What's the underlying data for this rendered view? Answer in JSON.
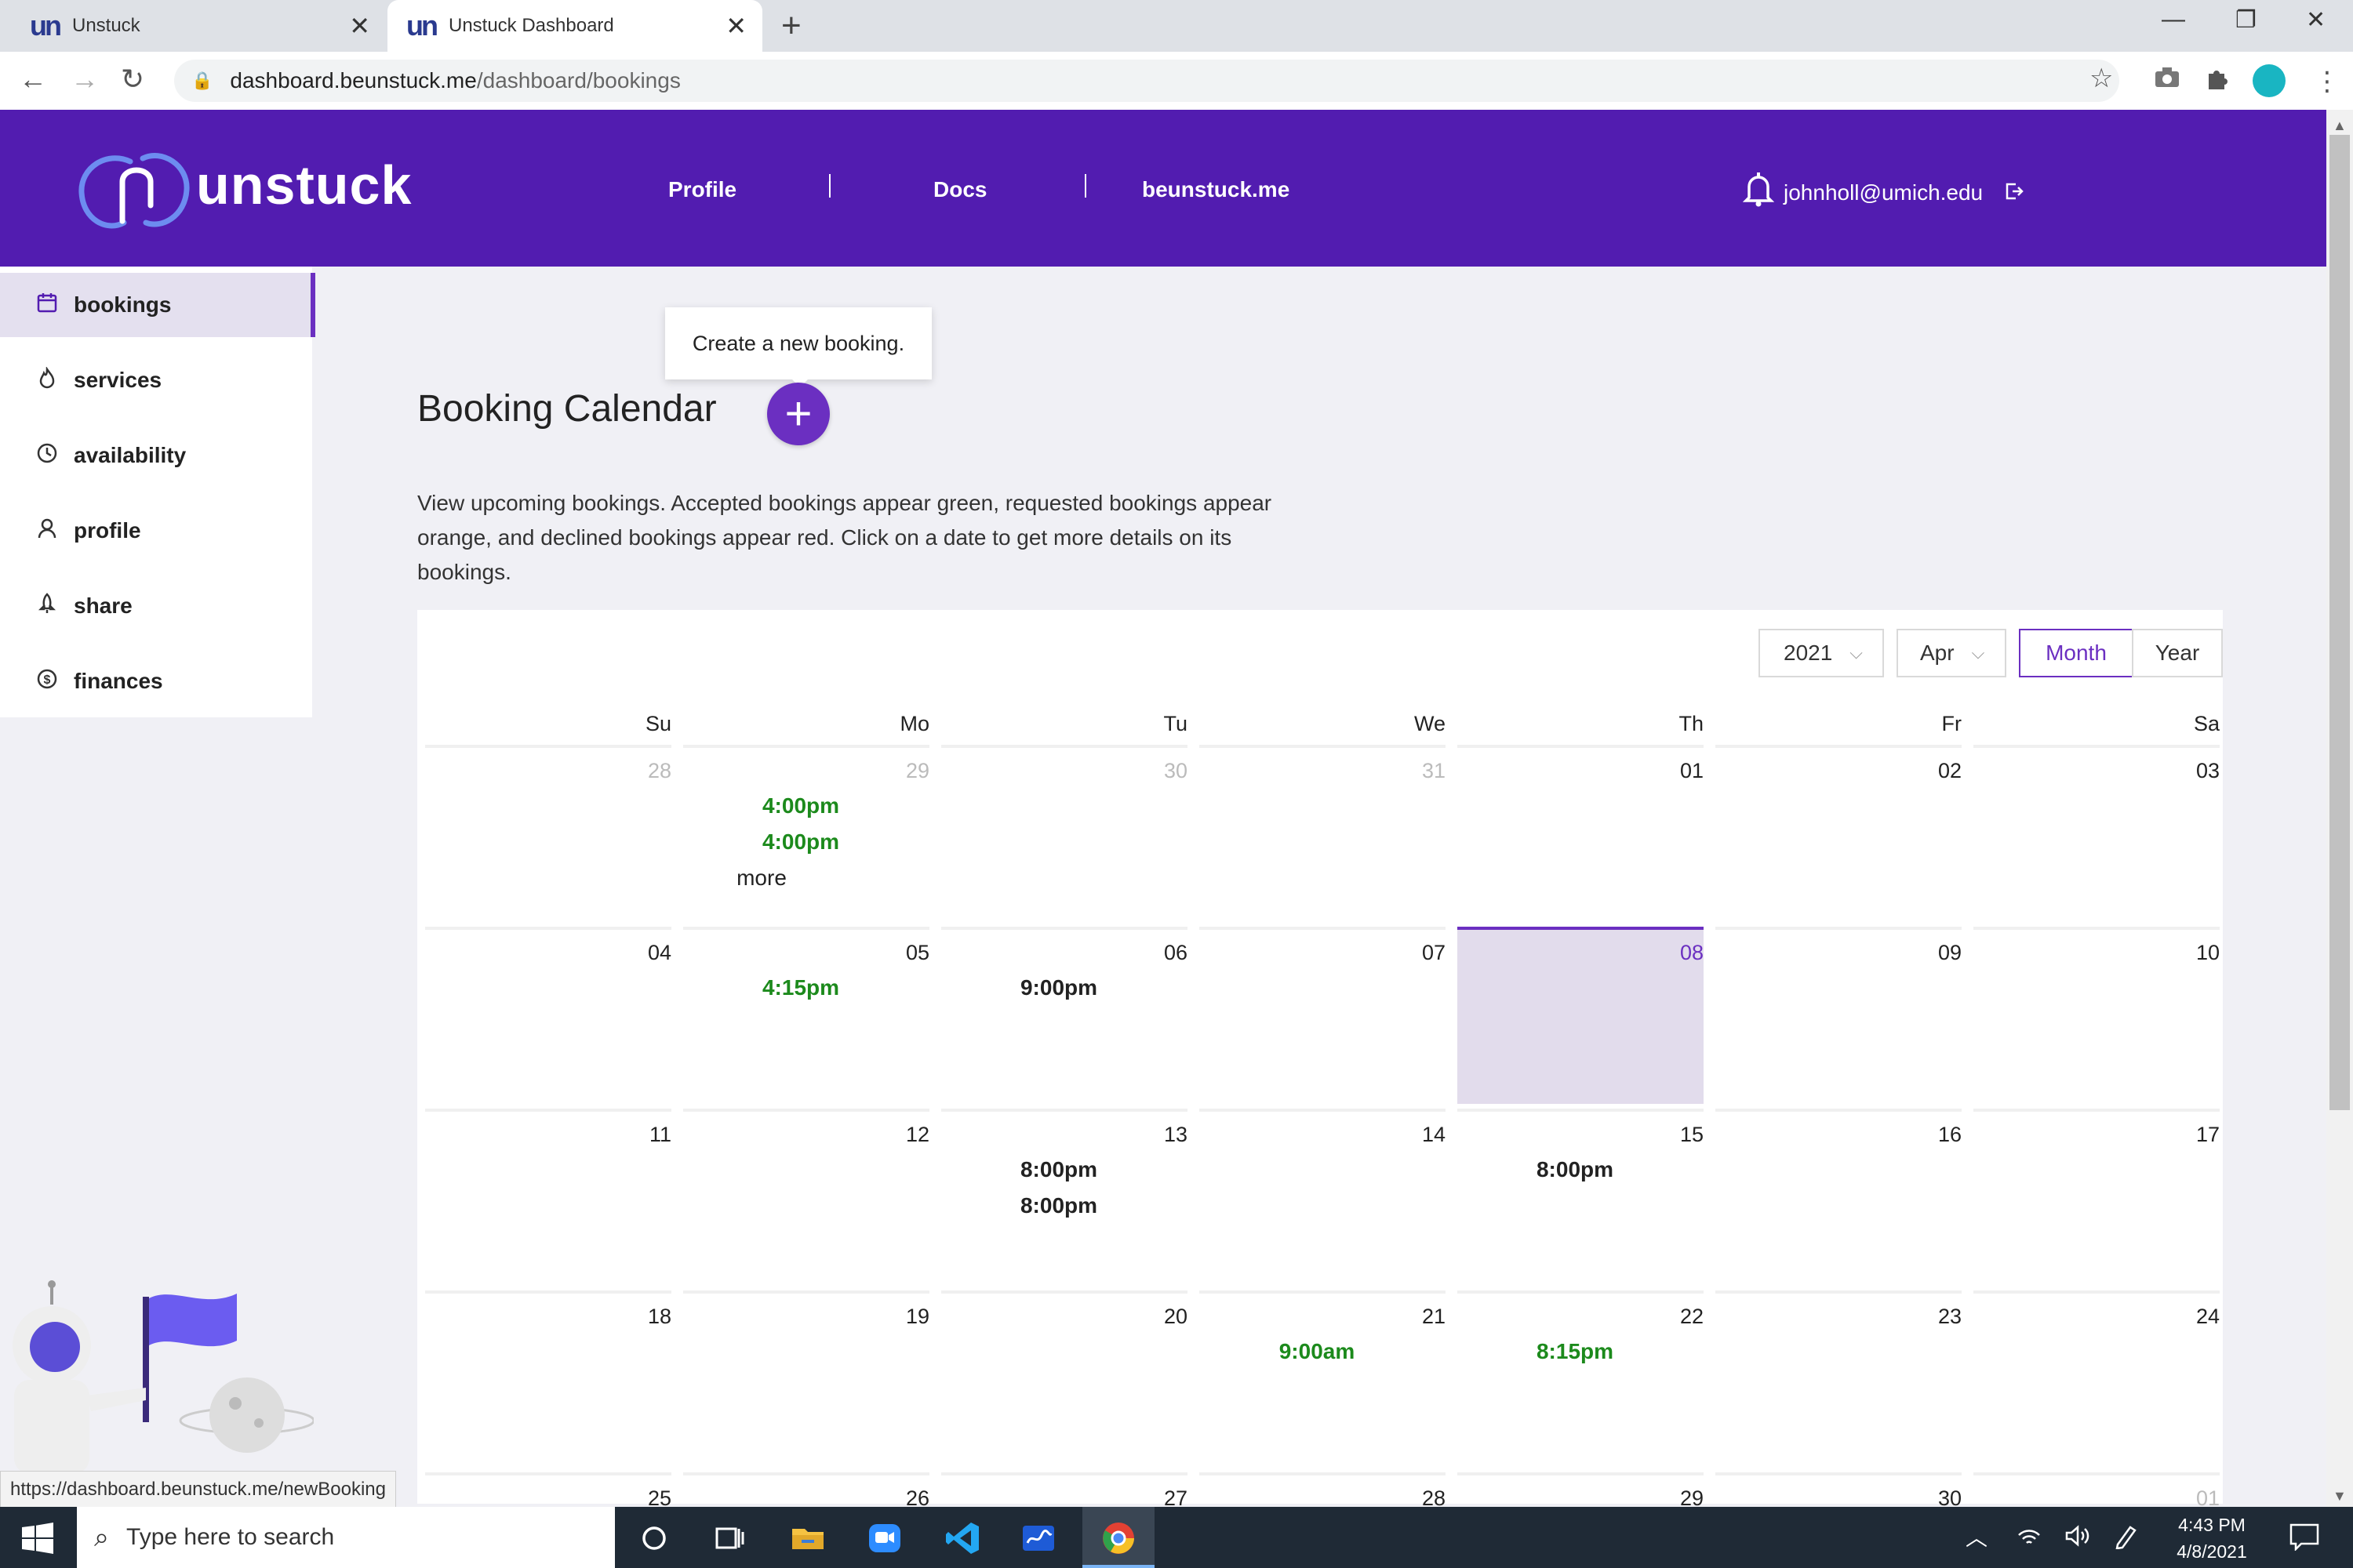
{
  "browser": {
    "tabs": [
      {
        "title": "Unstuck",
        "favicon": "un"
      },
      {
        "title": "Unstuck Dashboard",
        "favicon": "un"
      }
    ],
    "url_host": "dashboard.beunstuck.me",
    "url_path": "/dashboard/bookings",
    "status_url": "https://dashboard.beunstuck.me/newBooking"
  },
  "header": {
    "logo": "unstuck",
    "nav": [
      "Profile",
      "Docs",
      "beunstuck.me"
    ],
    "user_email": "johnholl@umich.edu"
  },
  "sidebar": {
    "items": [
      {
        "label": "bookings",
        "icon": "calendar-icon",
        "active": true
      },
      {
        "label": "services",
        "icon": "flame-icon"
      },
      {
        "label": "availability",
        "icon": "clock-icon"
      },
      {
        "label": "profile",
        "icon": "person-icon"
      },
      {
        "label": "share",
        "icon": "rocket-icon"
      },
      {
        "label": "finances",
        "icon": "dollar-circle-icon"
      }
    ]
  },
  "main": {
    "tooltip": "Create a new booking.",
    "title": "Booking Calendar",
    "description": "View upcoming bookings. Accepted bookings appear green, requested bookings appear orange, and declined bookings appear red. Click on a date to get more details on its bookings."
  },
  "calendar": {
    "year": "2021",
    "month": "Apr",
    "mode_month": "Month",
    "mode_year": "Year",
    "weekdays": [
      "Su",
      "Mo",
      "Tu",
      "We",
      "Th",
      "Fr",
      "Sa"
    ],
    "weeks": [
      [
        {
          "day": "28",
          "out": true,
          "events": []
        },
        {
          "day": "29",
          "out": true,
          "events": [
            {
              "time": "4:00pm",
              "status": "accepted"
            },
            {
              "time": "4:00pm",
              "status": "accepted"
            }
          ],
          "more": "more"
        },
        {
          "day": "30",
          "out": true,
          "events": []
        },
        {
          "day": "31",
          "out": true,
          "events": []
        },
        {
          "day": "01",
          "events": []
        },
        {
          "day": "02",
          "events": []
        },
        {
          "day": "03",
          "events": []
        }
      ],
      [
        {
          "day": "04",
          "events": []
        },
        {
          "day": "05",
          "events": [
            {
              "time": "4:15pm",
              "status": "accepted"
            }
          ]
        },
        {
          "day": "06",
          "events": [
            {
              "time": "9:00pm",
              "status": "other"
            }
          ]
        },
        {
          "day": "07",
          "events": []
        },
        {
          "day": "08",
          "today": true,
          "events": []
        },
        {
          "day": "09",
          "events": []
        },
        {
          "day": "10",
          "events": []
        }
      ],
      [
        {
          "day": "11",
          "events": []
        },
        {
          "day": "12",
          "events": []
        },
        {
          "day": "13",
          "events": [
            {
              "time": "8:00pm",
              "status": "other"
            },
            {
              "time": "8:00pm",
              "status": "other"
            }
          ]
        },
        {
          "day": "14",
          "events": []
        },
        {
          "day": "15",
          "events": [
            {
              "time": "8:00pm",
              "status": "other"
            }
          ]
        },
        {
          "day": "16",
          "events": []
        },
        {
          "day": "17",
          "events": []
        }
      ],
      [
        {
          "day": "18",
          "events": []
        },
        {
          "day": "19",
          "events": []
        },
        {
          "day": "20",
          "events": []
        },
        {
          "day": "21",
          "events": [
            {
              "time": "9:00am",
              "status": "accepted"
            }
          ]
        },
        {
          "day": "22",
          "events": [
            {
              "time": "8:15pm",
              "status": "accepted"
            }
          ]
        },
        {
          "day": "23",
          "events": []
        },
        {
          "day": "24",
          "events": []
        }
      ],
      [
        {
          "day": "25",
          "events": []
        },
        {
          "day": "26",
          "events": []
        },
        {
          "day": "27",
          "events": []
        },
        {
          "day": "28",
          "events": []
        },
        {
          "day": "29",
          "events": []
        },
        {
          "day": "30",
          "events": []
        },
        {
          "day": "01",
          "out": true,
          "events": []
        }
      ]
    ]
  },
  "colors": {
    "brand": "#521cb0",
    "accent": "#6b2fc1",
    "accepted": "#1c8a1c",
    "today_bg": "#e2dcec"
  },
  "taskbar": {
    "search_placeholder": "Type here to search",
    "time": "4:43 PM",
    "date": "4/8/2021"
  }
}
